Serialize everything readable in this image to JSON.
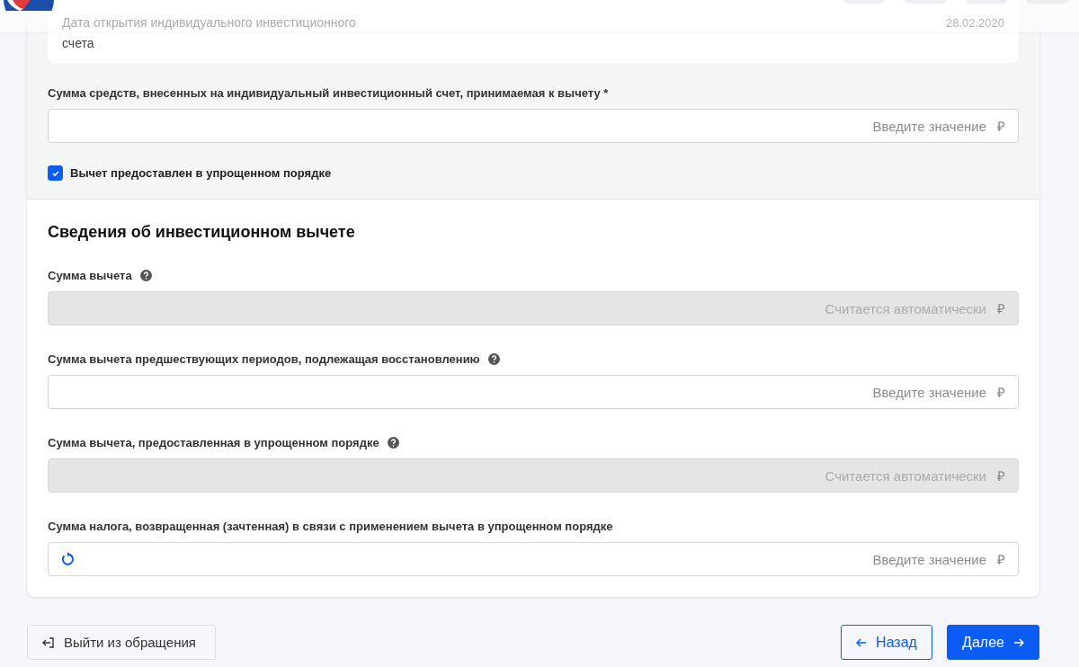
{
  "account_card": {
    "label": "Дата открытия индивидуального инвестиционного счета",
    "value": "28.02.2020"
  },
  "deposit_field": {
    "label": "Сумма средств, внесенных на индивидуальный инвестиционный счет, принимаемая к вычету *",
    "placeholder": "Введите значение",
    "currency": "₽"
  },
  "simplified_checkbox": {
    "label": "Вычет предоставлен в упрощенном порядке",
    "checked": true
  },
  "section": {
    "title": "Сведения об инвестиционном вычете",
    "fields": [
      {
        "label": "Сумма вычета",
        "help": true,
        "disabled": true,
        "reset": false,
        "placeholder": "Считается автоматически",
        "currency": "₽"
      },
      {
        "label": "Сумма вычета предшествующих периодов, подлежащая восстановлению",
        "help": true,
        "disabled": false,
        "reset": false,
        "placeholder": "Введите значение",
        "currency": "₽"
      },
      {
        "label": "Сумма вычета, предоставленная в упрощенном порядке",
        "help": true,
        "disabled": true,
        "reset": false,
        "placeholder": "Считается автоматически",
        "currency": "₽"
      },
      {
        "label": "Сумма налога, возвращенная (зачтенная) в связи с применением вычета в упрощенном порядке",
        "help": false,
        "disabled": false,
        "reset": true,
        "placeholder": "Введите значение",
        "currency": "₽"
      }
    ]
  },
  "footer": {
    "exit": "Выйти из обращения",
    "back": "Назад",
    "next": "Далее"
  }
}
